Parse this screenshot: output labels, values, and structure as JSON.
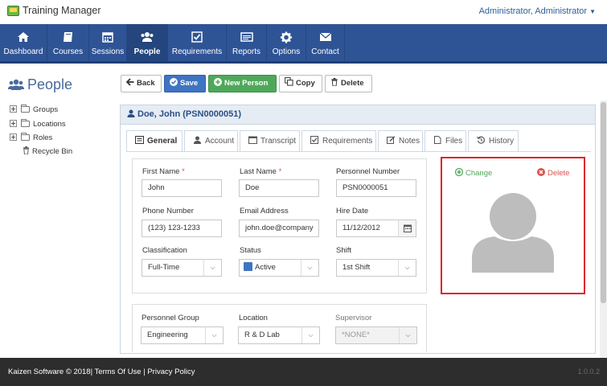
{
  "app": {
    "title": "Training Manager",
    "user": "Administrator, Administrator"
  },
  "nav": [
    {
      "label": "Dashboard",
      "icon": "home-icon"
    },
    {
      "label": "Courses",
      "icon": "book-icon"
    },
    {
      "label": "Sessions",
      "icon": "calendar-icon"
    },
    {
      "label": "People",
      "icon": "people-icon",
      "active": true
    },
    {
      "label": "Requirements",
      "icon": "checklist-icon"
    },
    {
      "label": "Reports",
      "icon": "report-icon"
    },
    {
      "label": "Options",
      "icon": "gear-icon"
    },
    {
      "label": "Contact",
      "icon": "envelope-icon"
    }
  ],
  "sidebar": {
    "heading": "People",
    "tree": [
      "Groups",
      "Locations",
      "Roles"
    ],
    "recycle_bin": "Recycle Bin"
  },
  "toolbar": {
    "back": "Back",
    "save": "Save",
    "new_person": "New Person",
    "copy": "Copy",
    "delete": "Delete"
  },
  "record": {
    "title": "Doe, John (PSN0000051)"
  },
  "tabs": [
    "General",
    "Account",
    "Transcript",
    "Requirements",
    "Notes",
    "Files",
    "History"
  ],
  "form": {
    "first_name": {
      "label": "First Name",
      "value": "John"
    },
    "last_name": {
      "label": "Last Name",
      "value": "Doe"
    },
    "personnel_number": {
      "label": "Personnel Number",
      "value": "PSN0000051"
    },
    "phone": {
      "label": "Phone Number",
      "value": "(123) 123-1233"
    },
    "email": {
      "label": "Email Address",
      "value": "john.doe@company"
    },
    "hire_date": {
      "label": "Hire Date",
      "value": "11/12/2012"
    },
    "classification": {
      "label": "Classification",
      "value": "Full-Time"
    },
    "status": {
      "label": "Status",
      "value": "Active",
      "color": "#3f74c2"
    },
    "shift": {
      "label": "Shift",
      "value": "1st Shift"
    },
    "personnel_group": {
      "label": "Personnel Group",
      "value": "Engineering"
    },
    "location": {
      "label": "Location",
      "value": "R & D Lab"
    },
    "supervisor": {
      "label": "Supervisor",
      "value": "*NONE*"
    }
  },
  "photo": {
    "change": "Change",
    "delete": "Delete"
  },
  "footer": {
    "copyright": "Kaizen Software © 2018",
    "terms": "Terms Of Use",
    "privacy": "Privacy Policy",
    "version": "1.0.0.2"
  },
  "colors": {
    "nav_bg": "#2f5495",
    "primary": "#3f74c2",
    "success": "#4fa85a",
    "danger": "#d9534f",
    "highlight": "#e2202a"
  }
}
